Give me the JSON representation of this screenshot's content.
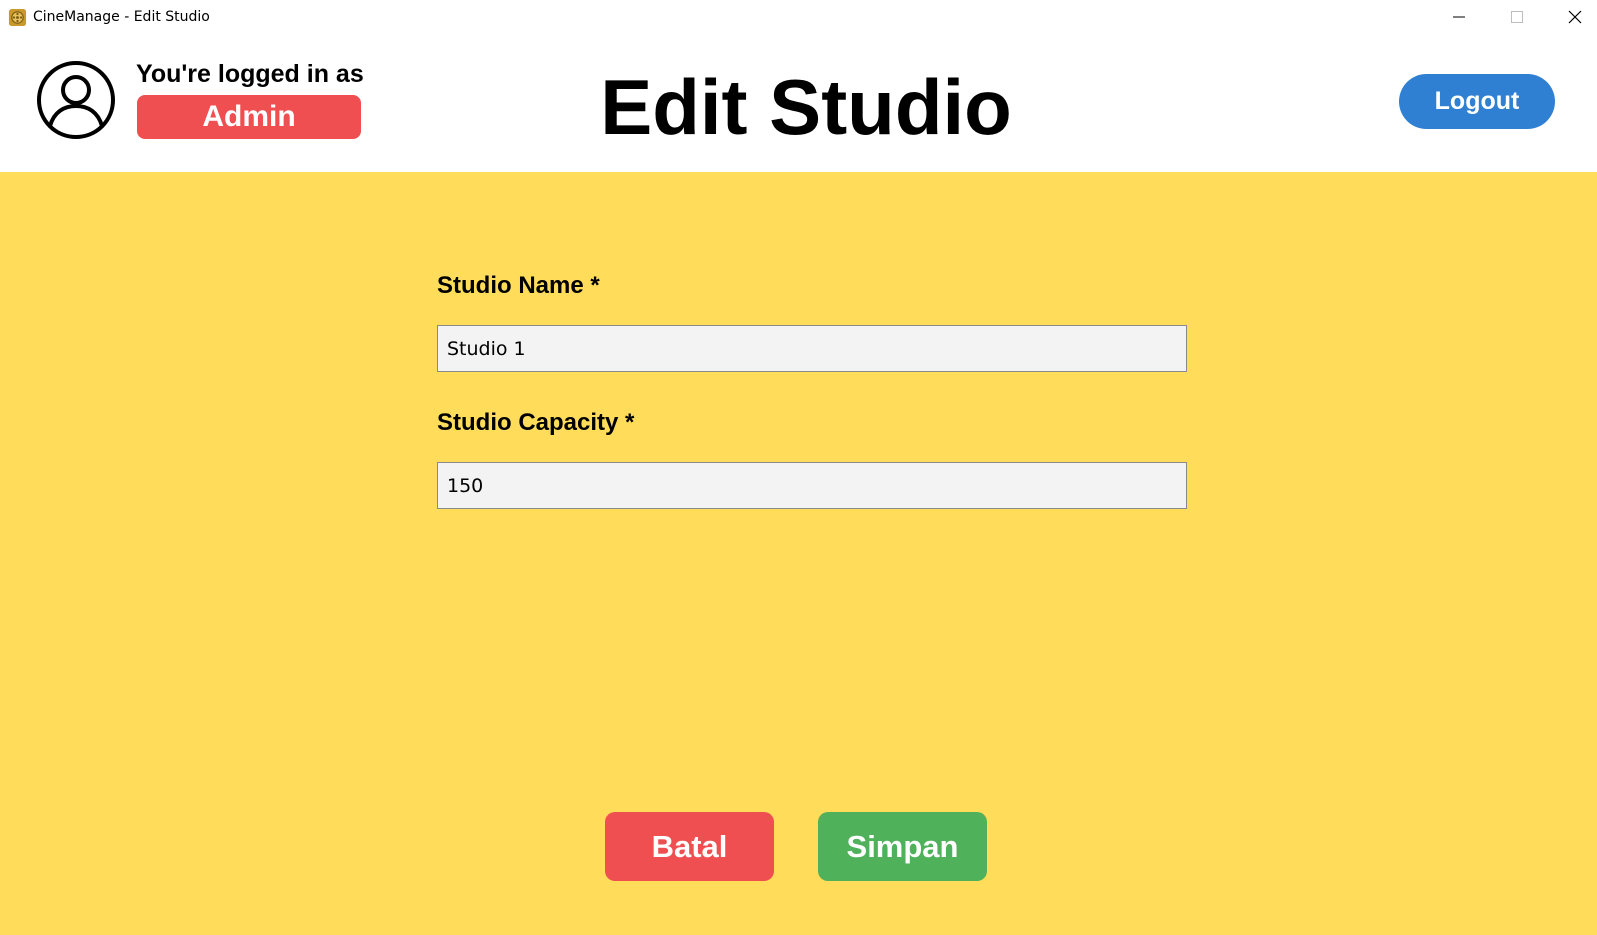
{
  "window": {
    "title": "CineManage - Edit Studio",
    "icon": "cinemanage-app-icon",
    "controls": [
      "minimize-icon",
      "maximize-icon",
      "close-icon"
    ]
  },
  "header": {
    "logged_in_text": "You're logged in as",
    "role": "Admin",
    "page_title": "Edit Studio",
    "logout_label": "Logout",
    "avatar_icon": "user-avatar-icon"
  },
  "form": {
    "studio_name_label": "Studio Name *",
    "studio_name_value": "Studio 1",
    "studio_capacity_label": "Studio Capacity *",
    "studio_capacity_value": "150"
  },
  "actions": {
    "cancel_label": "Batal",
    "save_label": "Simpan"
  },
  "colors": {
    "background": "#ffdc59",
    "role_badge": "#f04f51",
    "logout": "#2f80d2",
    "cancel": "#f04f51",
    "save": "#4fb15a"
  }
}
